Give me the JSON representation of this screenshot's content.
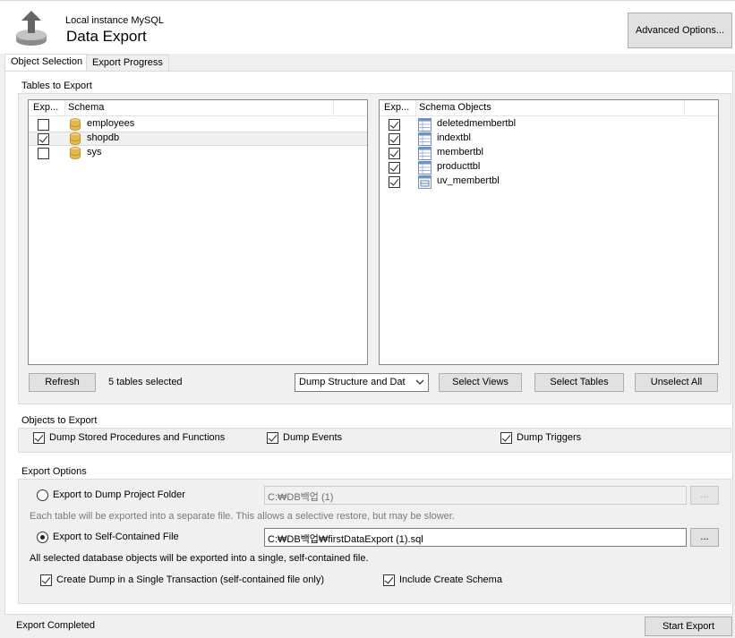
{
  "header": {
    "subtitle": "Local instance MySQL",
    "title": "Data Export",
    "advanced_options_label": "Advanced Options..."
  },
  "tabs": [
    {
      "label": "Object Selection",
      "active": true
    },
    {
      "label": "Export Progress",
      "active": false
    }
  ],
  "tables_to_export": {
    "group_label": "Tables to Export",
    "schema_list": {
      "columns": [
        "Exp...",
        "Schema"
      ],
      "rows": [
        {
          "name": "employees",
          "checked": false,
          "selected": false
        },
        {
          "name": "shopdb",
          "checked": true,
          "selected": true
        },
        {
          "name": "sys",
          "checked": false,
          "selected": false
        }
      ]
    },
    "objects_list": {
      "columns": [
        "Exp...",
        "Schema Objects"
      ],
      "rows": [
        {
          "name": "deletedmembertbl",
          "checked": true,
          "icon": "table-icon"
        },
        {
          "name": "indextbl",
          "checked": true,
          "icon": "table-icon"
        },
        {
          "name": "membertbl",
          "checked": true,
          "icon": "table-icon"
        },
        {
          "name": "producttbl",
          "checked": true,
          "icon": "table-icon"
        },
        {
          "name": "uv_membertbl",
          "checked": true,
          "icon": "view-icon"
        }
      ]
    },
    "refresh_label": "Refresh",
    "selected_count": "5 tables selected",
    "dump_mode": "Dump Structure and Dat",
    "select_views_label": "Select Views",
    "select_tables_label": "Select Tables",
    "unselect_all_label": "Unselect All"
  },
  "objects_to_export": {
    "group_label": "Objects to Export",
    "options": [
      {
        "label": "Dump Stored Procedures and Functions",
        "checked": true
      },
      {
        "label": "Dump Events",
        "checked": true
      },
      {
        "label": "Dump Triggers",
        "checked": true
      }
    ]
  },
  "export_options": {
    "group_label": "Export Options",
    "dump_folder": {
      "label": "Export to Dump Project Folder",
      "selected": false,
      "path": "C:₩DB백업 (1)",
      "browse_label": "...",
      "hint": "Each table will be exported into a separate file. This allows a selective restore, but may be slower."
    },
    "self_contained": {
      "label": "Export to Self-Contained File",
      "selected": true,
      "path": "C:₩DB백업₩firstDataExport (1).sql",
      "browse_label": "...",
      "hint": "All selected database objects will be exported into a single, self-contained file."
    },
    "single_transaction": {
      "label": "Create Dump in a Single Transaction (self-contained file only)",
      "checked": true
    },
    "include_create_schema": {
      "label": "Include Create Schema",
      "checked": true
    }
  },
  "footer": {
    "status": "Export Completed",
    "start_export_label": "Start Export"
  },
  "colors": {
    "table_icon": "#6f8fcf",
    "db_icon": "#e8b84a"
  }
}
